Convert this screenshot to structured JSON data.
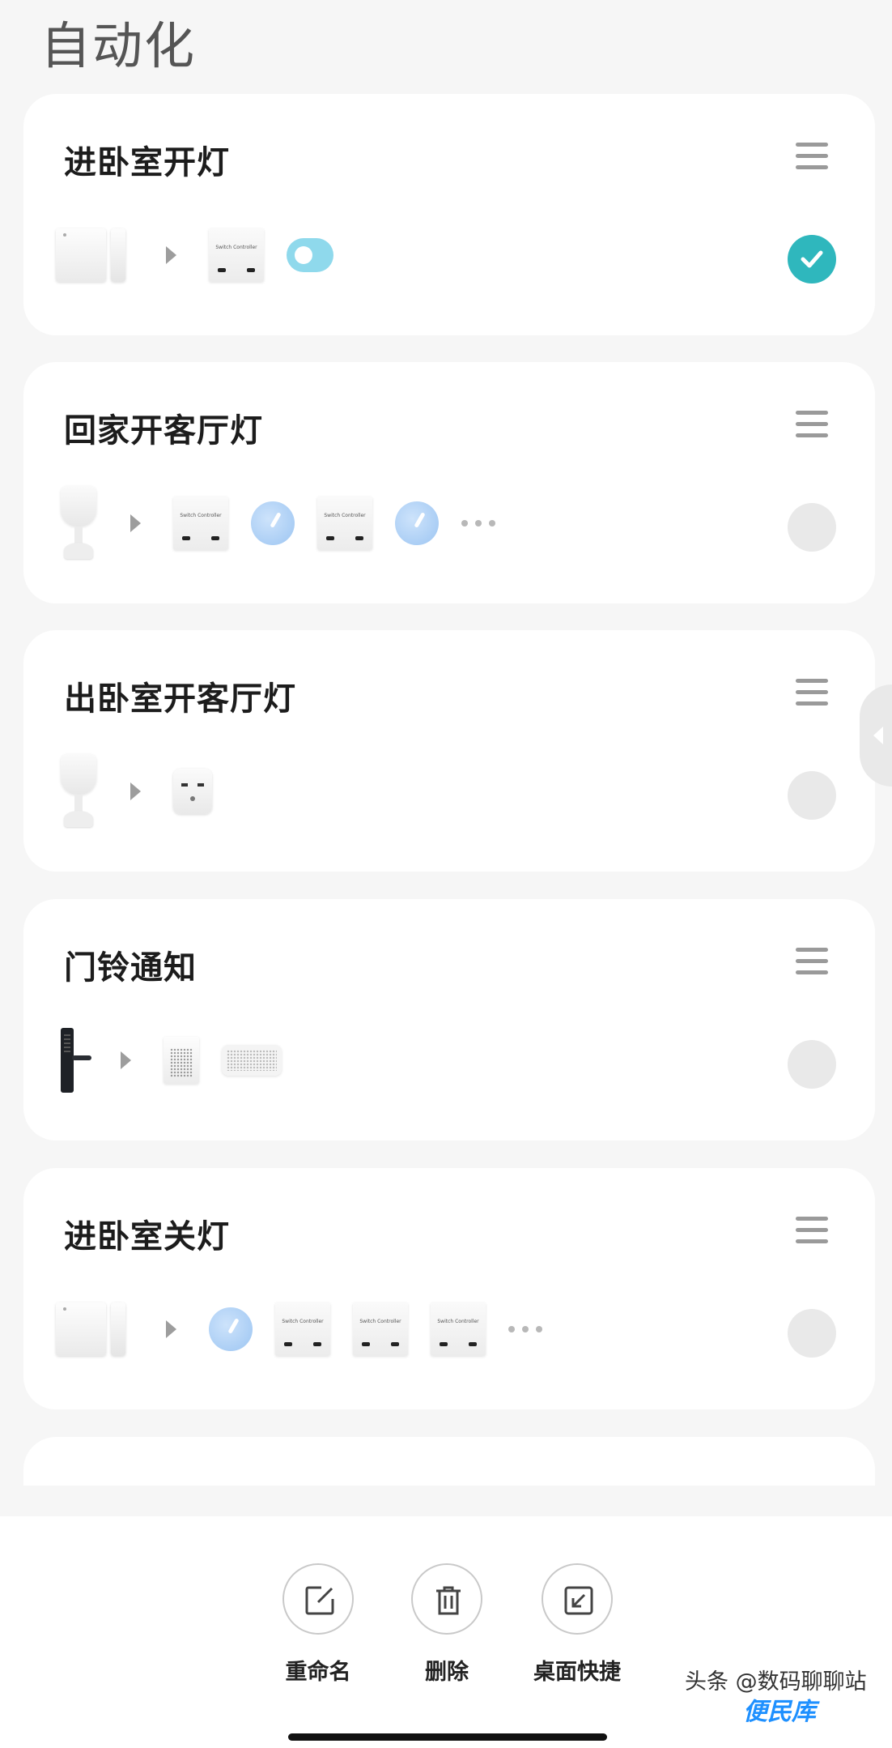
{
  "page": {
    "title": "自动化"
  },
  "automations": [
    {
      "title": "进卧室开灯",
      "enabled": true,
      "devices": [
        "door-sensor",
        "arrow",
        "switch-controller",
        "toggle-switch"
      ]
    },
    {
      "title": "回家开客厅灯",
      "enabled": false,
      "devices": [
        "motion-sensor",
        "arrow",
        "switch-controller",
        "knob",
        "switch-controller",
        "knob",
        "more"
      ]
    },
    {
      "title": "出卧室开客厅灯",
      "enabled": false,
      "devices": [
        "motion-sensor",
        "arrow",
        "smart-plug"
      ]
    },
    {
      "title": "门铃通知",
      "enabled": false,
      "devices": [
        "door-lock",
        "arrow",
        "air-purifier",
        "smart-speaker"
      ]
    },
    {
      "title": "进卧室关灯",
      "enabled": false,
      "devices": [
        "door-sensor",
        "arrow",
        "knob",
        "switch-controller",
        "switch-controller",
        "switch-controller",
        "more"
      ]
    }
  ],
  "device_label": {
    "switch_controller": "Switch Controller"
  },
  "actions": {
    "rename": "重命名",
    "delete": "删除",
    "shortcut": "桌面快捷"
  },
  "watermark": {
    "line1": "头条 @数码聊聊站",
    "line2": "便民库"
  },
  "colors": {
    "accent": "#2fb7bd",
    "background": "#f6f6f6"
  }
}
